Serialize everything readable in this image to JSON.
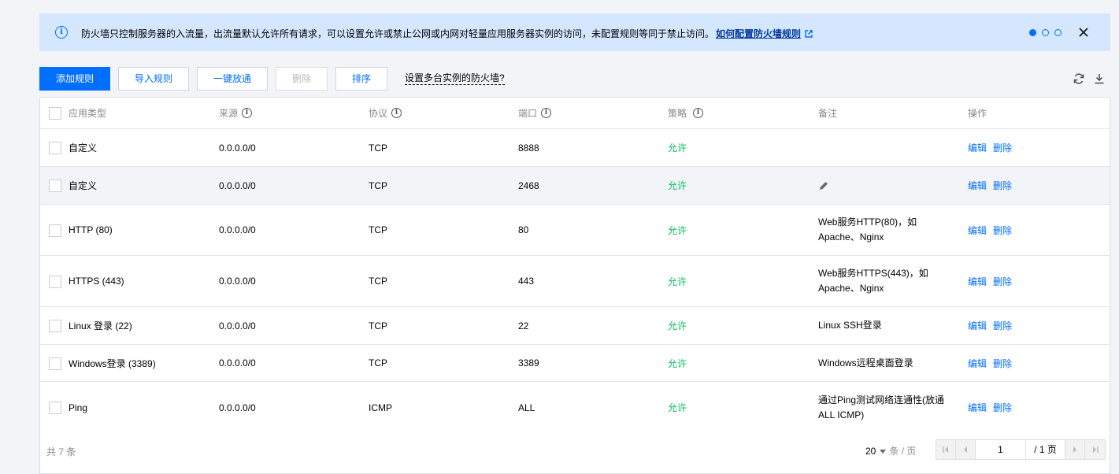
{
  "notice": {
    "message": "防火墙只控制服务器的入流量，出流量默认允许所有请求，可以设置允许或禁止公网或内网对轻量应用服务器实例的访问，未配置规则等同于禁止访问。",
    "link": "如何配置防火墙规则"
  },
  "toolbar": {
    "add": "添加规则",
    "import": "导入规则",
    "allow_all": "一键放通",
    "delete": "删除",
    "sort": "排序",
    "help": "设置多台实例的防火墙?"
  },
  "table": {
    "headers": {
      "type": "应用类型",
      "source": "来源",
      "protocol": "协议",
      "port": "端口",
      "policy": "策略",
      "note": "备注",
      "action": "操作"
    },
    "rows": [
      {
        "type": "自定义",
        "source": "0.0.0.0/0",
        "protocol": "TCP",
        "port": "8888",
        "policy": "允许",
        "note": "",
        "note2": ""
      },
      {
        "type": "自定义",
        "source": "0.0.0.0/0",
        "protocol": "TCP",
        "port": "2468",
        "policy": "允许",
        "note": "",
        "note2": ""
      },
      {
        "type": "HTTP (80)",
        "source": "0.0.0.0/0",
        "protocol": "TCP",
        "port": "80",
        "policy": "允许",
        "note": "Web服务HTTP(80)，如",
        "note2": "Apache、Nginx"
      },
      {
        "type": "HTTPS (443)",
        "source": "0.0.0.0/0",
        "protocol": "TCP",
        "port": "443",
        "policy": "允许",
        "note": "Web服务HTTPS(443)，如",
        "note2": "Apache、Nginx"
      },
      {
        "type": "Linux 登录 (22)",
        "source": "0.0.0.0/0",
        "protocol": "TCP",
        "port": "22",
        "policy": "允许",
        "note": "Linux SSH登录",
        "note2": ""
      },
      {
        "type": "Windows登录 (3389)",
        "source": "0.0.0.0/0",
        "protocol": "TCP",
        "port": "3389",
        "policy": "允许",
        "note": "Windows远程桌面登录",
        "note2": ""
      },
      {
        "type": "Ping",
        "source": "0.0.0.0/0",
        "protocol": "ICMP",
        "port": "ALL",
        "policy": "允许",
        "note": "通过Ping测试网络连通性(放通",
        "note2": "ALL ICMP)"
      }
    ],
    "edit": "编辑",
    "del": "删除"
  },
  "footer": {
    "total": "共 7 条",
    "page_size": "20",
    "page_size_unit": "条 / 页",
    "page": "1",
    "page_total": "/ 1 页"
  },
  "colors": {
    "primary": "#006eff",
    "allow": "#0abf5b",
    "notice_bg": "#d5e7ff"
  }
}
